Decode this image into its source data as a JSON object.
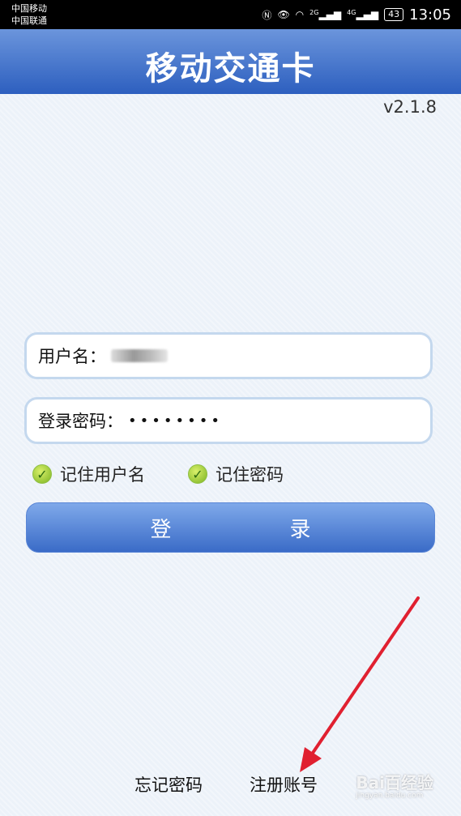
{
  "status_bar": {
    "carrier1": "中国移动",
    "carrier2": "中国联通",
    "net1": "2G",
    "net2": "4G",
    "battery": "43",
    "time": "13:05"
  },
  "header": {
    "title": "移动交通卡"
  },
  "version": "v2.1.8",
  "form": {
    "username_label": "用户名：",
    "password_label": "登录密码：",
    "password_value": "••••••••",
    "remember_username": "记住用户名",
    "remember_password": "记住密码",
    "login_button": "登　录"
  },
  "footer": {
    "forgot_password": "忘记密码",
    "register": "注册账号"
  },
  "watermark": {
    "text": "Bai百经验",
    "sub": "jingyan.baidu.com"
  },
  "colors": {
    "header": "#2d5fbf",
    "button": "#3a6bc7",
    "arrow": "#e02030"
  }
}
